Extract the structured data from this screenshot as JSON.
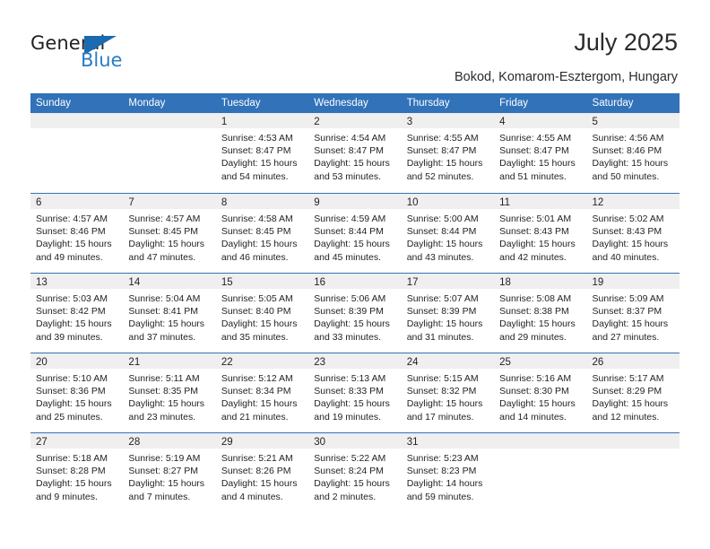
{
  "brand": {
    "name_dark": "General",
    "name_blue": "Blue",
    "triangle_icon": "triangle-icon",
    "accent_color": "#2b7cc4"
  },
  "header": {
    "title": "July 2025",
    "subtitle": "Bokod, Komarom-Esztergom, Hungary"
  },
  "calendar": {
    "header_color": "#3172b9",
    "daynum_band_color": "#efefef",
    "weekdays": [
      "Sunday",
      "Monday",
      "Tuesday",
      "Wednesday",
      "Thursday",
      "Friday",
      "Saturday"
    ],
    "weeks": [
      [
        {
          "day": "",
          "empty": true
        },
        {
          "day": "",
          "empty": true
        },
        {
          "day": "1",
          "sunrise": "Sunrise: 4:53 AM",
          "sunset": "Sunset: 8:47 PM",
          "daylight_1": "Daylight: 15 hours",
          "daylight_2": "and 54 minutes."
        },
        {
          "day": "2",
          "sunrise": "Sunrise: 4:54 AM",
          "sunset": "Sunset: 8:47 PM",
          "daylight_1": "Daylight: 15 hours",
          "daylight_2": "and 53 minutes."
        },
        {
          "day": "3",
          "sunrise": "Sunrise: 4:55 AM",
          "sunset": "Sunset: 8:47 PM",
          "daylight_1": "Daylight: 15 hours",
          "daylight_2": "and 52 minutes."
        },
        {
          "day": "4",
          "sunrise": "Sunrise: 4:55 AM",
          "sunset": "Sunset: 8:47 PM",
          "daylight_1": "Daylight: 15 hours",
          "daylight_2": "and 51 minutes."
        },
        {
          "day": "5",
          "sunrise": "Sunrise: 4:56 AM",
          "sunset": "Sunset: 8:46 PM",
          "daylight_1": "Daylight: 15 hours",
          "daylight_2": "and 50 minutes."
        }
      ],
      [
        {
          "day": "6",
          "sunrise": "Sunrise: 4:57 AM",
          "sunset": "Sunset: 8:46 PM",
          "daylight_1": "Daylight: 15 hours",
          "daylight_2": "and 49 minutes."
        },
        {
          "day": "7",
          "sunrise": "Sunrise: 4:57 AM",
          "sunset": "Sunset: 8:45 PM",
          "daylight_1": "Daylight: 15 hours",
          "daylight_2": "and 47 minutes."
        },
        {
          "day": "8",
          "sunrise": "Sunrise: 4:58 AM",
          "sunset": "Sunset: 8:45 PM",
          "daylight_1": "Daylight: 15 hours",
          "daylight_2": "and 46 minutes."
        },
        {
          "day": "9",
          "sunrise": "Sunrise: 4:59 AM",
          "sunset": "Sunset: 8:44 PM",
          "daylight_1": "Daylight: 15 hours",
          "daylight_2": "and 45 minutes."
        },
        {
          "day": "10",
          "sunrise": "Sunrise: 5:00 AM",
          "sunset": "Sunset: 8:44 PM",
          "daylight_1": "Daylight: 15 hours",
          "daylight_2": "and 43 minutes."
        },
        {
          "day": "11",
          "sunrise": "Sunrise: 5:01 AM",
          "sunset": "Sunset: 8:43 PM",
          "daylight_1": "Daylight: 15 hours",
          "daylight_2": "and 42 minutes."
        },
        {
          "day": "12",
          "sunrise": "Sunrise: 5:02 AM",
          "sunset": "Sunset: 8:43 PM",
          "daylight_1": "Daylight: 15 hours",
          "daylight_2": "and 40 minutes."
        }
      ],
      [
        {
          "day": "13",
          "sunrise": "Sunrise: 5:03 AM",
          "sunset": "Sunset: 8:42 PM",
          "daylight_1": "Daylight: 15 hours",
          "daylight_2": "and 39 minutes."
        },
        {
          "day": "14",
          "sunrise": "Sunrise: 5:04 AM",
          "sunset": "Sunset: 8:41 PM",
          "daylight_1": "Daylight: 15 hours",
          "daylight_2": "and 37 minutes."
        },
        {
          "day": "15",
          "sunrise": "Sunrise: 5:05 AM",
          "sunset": "Sunset: 8:40 PM",
          "daylight_1": "Daylight: 15 hours",
          "daylight_2": "and 35 minutes."
        },
        {
          "day": "16",
          "sunrise": "Sunrise: 5:06 AM",
          "sunset": "Sunset: 8:39 PM",
          "daylight_1": "Daylight: 15 hours",
          "daylight_2": "and 33 minutes."
        },
        {
          "day": "17",
          "sunrise": "Sunrise: 5:07 AM",
          "sunset": "Sunset: 8:39 PM",
          "daylight_1": "Daylight: 15 hours",
          "daylight_2": "and 31 minutes."
        },
        {
          "day": "18",
          "sunrise": "Sunrise: 5:08 AM",
          "sunset": "Sunset: 8:38 PM",
          "daylight_1": "Daylight: 15 hours",
          "daylight_2": "and 29 minutes."
        },
        {
          "day": "19",
          "sunrise": "Sunrise: 5:09 AM",
          "sunset": "Sunset: 8:37 PM",
          "daylight_1": "Daylight: 15 hours",
          "daylight_2": "and 27 minutes."
        }
      ],
      [
        {
          "day": "20",
          "sunrise": "Sunrise: 5:10 AM",
          "sunset": "Sunset: 8:36 PM",
          "daylight_1": "Daylight: 15 hours",
          "daylight_2": "and 25 minutes."
        },
        {
          "day": "21",
          "sunrise": "Sunrise: 5:11 AM",
          "sunset": "Sunset: 8:35 PM",
          "daylight_1": "Daylight: 15 hours",
          "daylight_2": "and 23 minutes."
        },
        {
          "day": "22",
          "sunrise": "Sunrise: 5:12 AM",
          "sunset": "Sunset: 8:34 PM",
          "daylight_1": "Daylight: 15 hours",
          "daylight_2": "and 21 minutes."
        },
        {
          "day": "23",
          "sunrise": "Sunrise: 5:13 AM",
          "sunset": "Sunset: 8:33 PM",
          "daylight_1": "Daylight: 15 hours",
          "daylight_2": "and 19 minutes."
        },
        {
          "day": "24",
          "sunrise": "Sunrise: 5:15 AM",
          "sunset": "Sunset: 8:32 PM",
          "daylight_1": "Daylight: 15 hours",
          "daylight_2": "and 17 minutes."
        },
        {
          "day": "25",
          "sunrise": "Sunrise: 5:16 AM",
          "sunset": "Sunset: 8:30 PM",
          "daylight_1": "Daylight: 15 hours",
          "daylight_2": "and 14 minutes."
        },
        {
          "day": "26",
          "sunrise": "Sunrise: 5:17 AM",
          "sunset": "Sunset: 8:29 PM",
          "daylight_1": "Daylight: 15 hours",
          "daylight_2": "and 12 minutes."
        }
      ],
      [
        {
          "day": "27",
          "sunrise": "Sunrise: 5:18 AM",
          "sunset": "Sunset: 8:28 PM",
          "daylight_1": "Daylight: 15 hours",
          "daylight_2": "and 9 minutes."
        },
        {
          "day": "28",
          "sunrise": "Sunrise: 5:19 AM",
          "sunset": "Sunset: 8:27 PM",
          "daylight_1": "Daylight: 15 hours",
          "daylight_2": "and 7 minutes."
        },
        {
          "day": "29",
          "sunrise": "Sunrise: 5:21 AM",
          "sunset": "Sunset: 8:26 PM",
          "daylight_1": "Daylight: 15 hours",
          "daylight_2": "and 4 minutes."
        },
        {
          "day": "30",
          "sunrise": "Sunrise: 5:22 AM",
          "sunset": "Sunset: 8:24 PM",
          "daylight_1": "Daylight: 15 hours",
          "daylight_2": "and 2 minutes."
        },
        {
          "day": "31",
          "sunrise": "Sunrise: 5:23 AM",
          "sunset": "Sunset: 8:23 PM",
          "daylight_1": "Daylight: 14 hours",
          "daylight_2": "and 59 minutes."
        },
        {
          "day": "",
          "empty": true
        },
        {
          "day": "",
          "empty": true
        }
      ]
    ]
  }
}
